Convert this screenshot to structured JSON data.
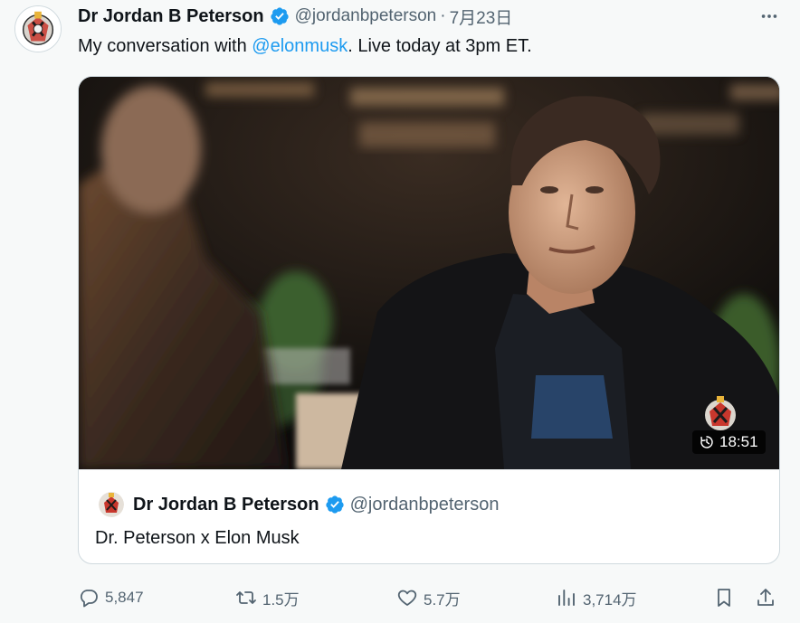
{
  "author": {
    "name": "Dr Jordan B Peterson",
    "handle": "@jordanbpeterson",
    "separator": "·",
    "date": "7月23日"
  },
  "tweet": {
    "text_before": "My conversation with ",
    "mention": "@elonmusk",
    "text_after": ". Live today at 3pm ET."
  },
  "video_card": {
    "duration": "18:51",
    "author_name": "Dr Jordan B Peterson",
    "author_handle": "@jordanbpeterson",
    "title": "Dr. Peterson x Elon Musk"
  },
  "actions": {
    "replies": "5,847",
    "reposts": "1.5万",
    "likes": "5.7万",
    "views": "3,714万"
  },
  "colors": {
    "accent": "#1d9bf0",
    "secondary_text": "#536471",
    "border": "#cfd9de"
  },
  "icons": [
    "more-icon",
    "verified-badge-icon",
    "history-icon",
    "reply-icon",
    "repost-icon",
    "like-icon",
    "views-icon",
    "bookmark-icon",
    "share-icon"
  ]
}
